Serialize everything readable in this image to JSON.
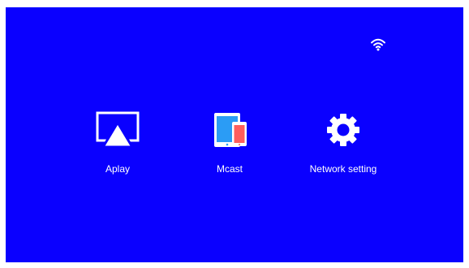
{
  "status_bar": {
    "wifi_icon": "wifi-icon"
  },
  "apps": [
    {
      "label": "Aplay",
      "icon": "airplay-icon"
    },
    {
      "label": "Mcast",
      "icon": "devices-icon"
    },
    {
      "label": "Network setting",
      "icon": "gear-icon"
    }
  ],
  "colors": {
    "background": "#0a00ff",
    "foreground": "#ffffff",
    "tablet_blue": "#2b9cf5",
    "phone_red": "#ff5d5d"
  }
}
